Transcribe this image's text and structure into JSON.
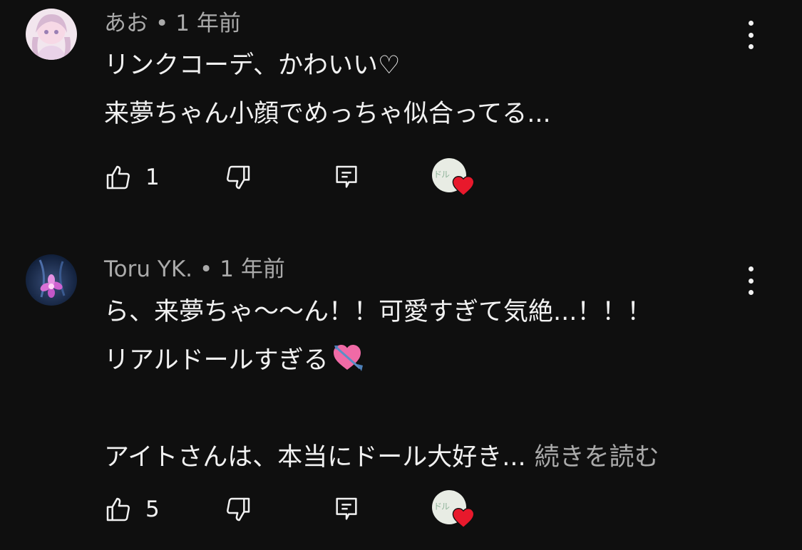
{
  "comments": [
    {
      "author": "あお",
      "separator": "•",
      "time": "1 年前",
      "lines": [
        "リンクコーデ、かわいい♡",
        "来夢ちゃん小顔でめっちゃ似合ってる..."
      ],
      "likes": "1",
      "creator_heart_badge": "ドル"
    },
    {
      "author": "Toru YK.",
      "separator": "•",
      "time": "1 年前",
      "lines": [
        "ら、来夢ちゃ〜〜ん！！可愛すぎて気絶...！！！",
        "リアルドールすぎる",
        "",
        "アイトさんは、本当にドール大好き..."
      ],
      "read_more": "続きを読む",
      "likes": "5",
      "creator_heart_badge": "ドル"
    }
  ],
  "icons": {
    "like": "thumbs-up-icon",
    "dislike": "thumbs-down-icon",
    "reply": "reply-icon",
    "more": "more-vertical-icon",
    "creator_heart": "heart-icon",
    "emoji": "heart-with-arrow-emoji"
  },
  "colors": {
    "background": "#0f0f0f",
    "text": "#f1f1f1",
    "secondary_text": "#aaaaaa",
    "heart": "#e8192c"
  }
}
